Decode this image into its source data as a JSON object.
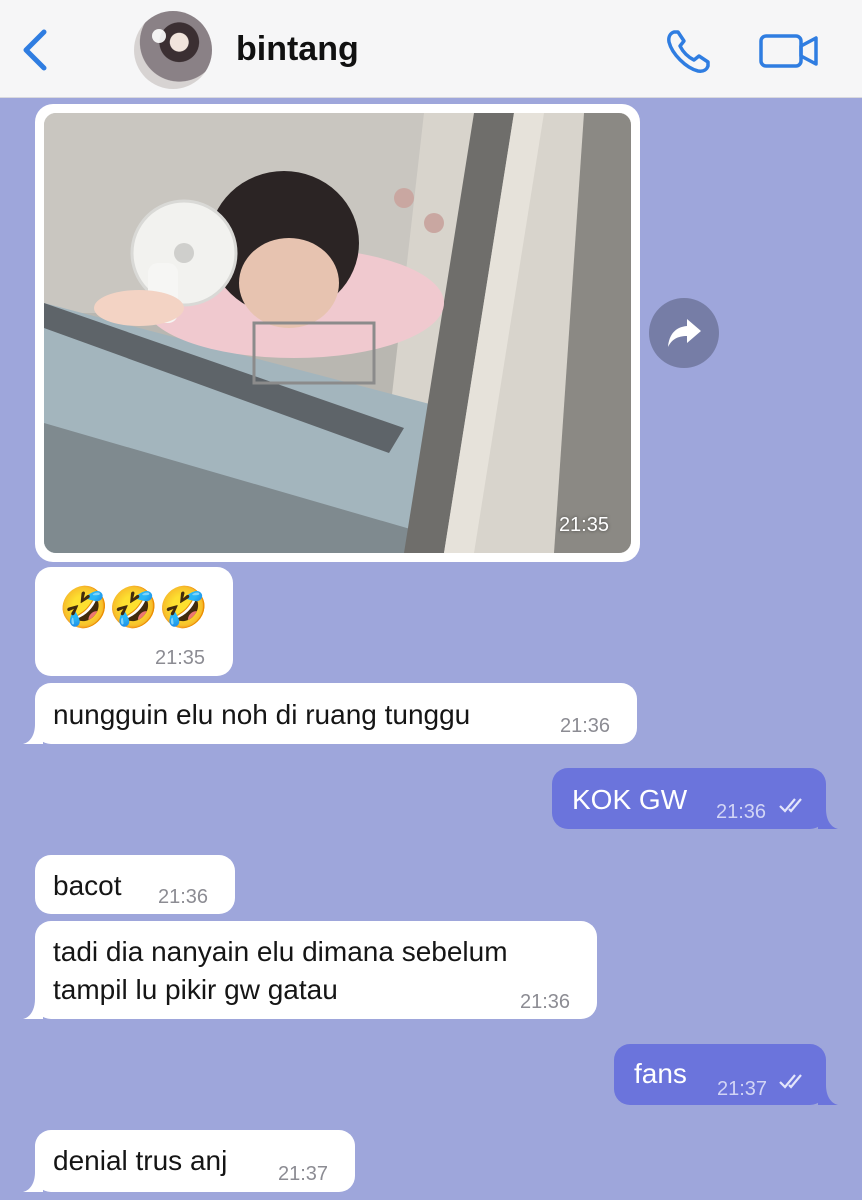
{
  "header": {
    "contact_name": "bintang",
    "accent_color": "#2f7de1",
    "icons": [
      "chevron-left-icon",
      "phone-icon",
      "video-camera-icon",
      "forward-icon"
    ]
  },
  "messages": [
    {
      "type": "image",
      "direction": "incoming",
      "time": "21:35"
    },
    {
      "type": "text",
      "direction": "incoming",
      "text": "🤣🤣🤣",
      "time": "21:35"
    },
    {
      "type": "text",
      "direction": "incoming",
      "text": "nungguin elu noh di ruang tunggu",
      "time": "21:36"
    },
    {
      "type": "text",
      "direction": "outgoing",
      "text": "KOK GW",
      "time": "21:36",
      "status": "read"
    },
    {
      "type": "text",
      "direction": "incoming",
      "text": "bacot",
      "time": "21:36"
    },
    {
      "type": "text",
      "direction": "incoming",
      "lines": [
        "tadi dia nanyain elu dimana sebelum",
        "tampil lu pikir gw gatau"
      ],
      "time": "21:36"
    },
    {
      "type": "text",
      "direction": "outgoing",
      "text": "fans",
      "time": "21:37",
      "status": "read"
    },
    {
      "type": "text",
      "direction": "incoming",
      "text": "denial trus anj",
      "time": "21:37"
    }
  ],
  "colors": {
    "background": "#9ea6db",
    "incoming_bubble": "#ffffff",
    "outgoing_bubble": "#6b74dc",
    "header": "#f6f6f7"
  }
}
